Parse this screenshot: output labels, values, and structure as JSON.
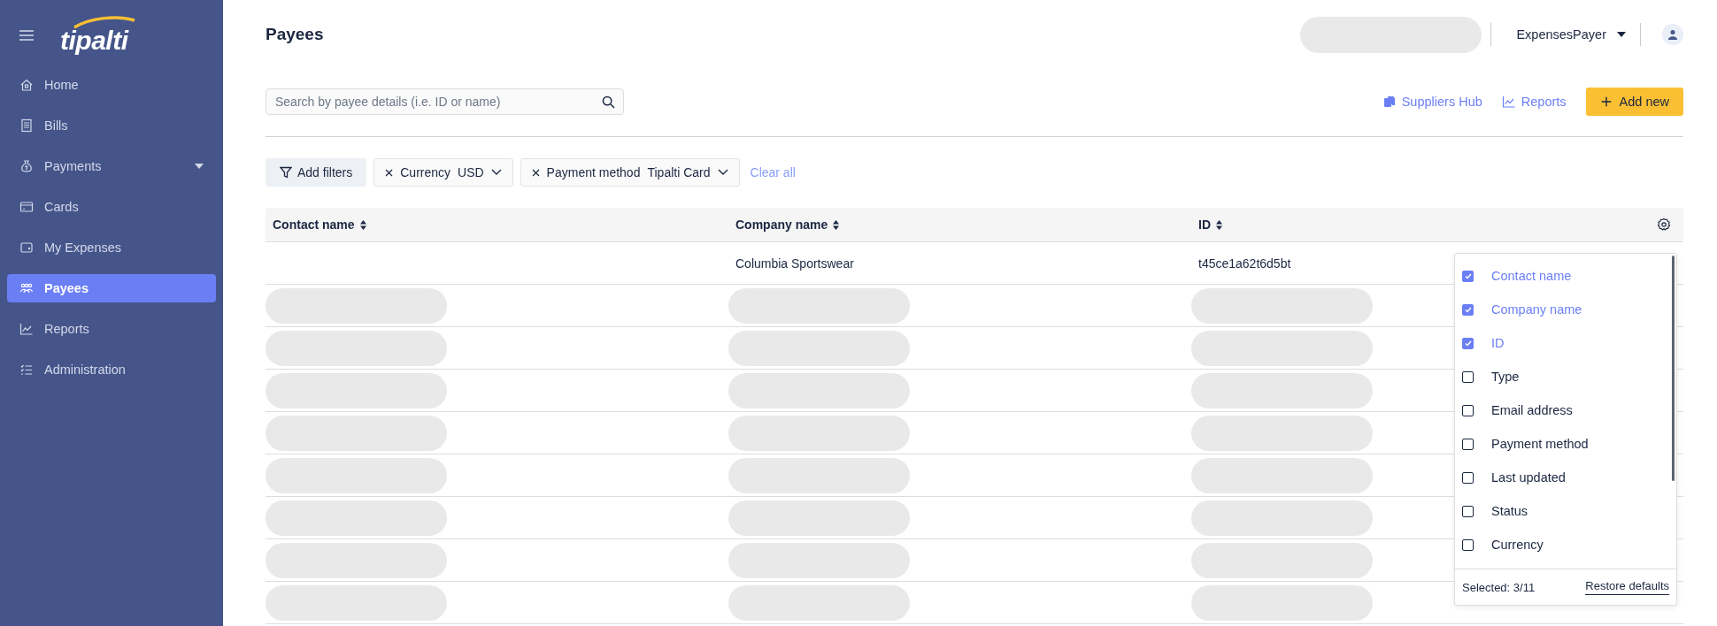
{
  "sidebar": {
    "logo": "tipalti",
    "items": [
      {
        "label": "Home",
        "selected": false,
        "expandable": false
      },
      {
        "label": "Bills",
        "selected": false,
        "expandable": false
      },
      {
        "label": "Payments",
        "selected": false,
        "expandable": true
      },
      {
        "label": "Cards",
        "selected": false,
        "expandable": false
      },
      {
        "label": "My Expenses",
        "selected": false,
        "expandable": false
      },
      {
        "label": "Payees",
        "selected": true,
        "expandable": false
      },
      {
        "label": "Reports",
        "selected": false,
        "expandable": false
      },
      {
        "label": "Administration",
        "selected": false,
        "expandable": false
      }
    ]
  },
  "header": {
    "title": "Payees",
    "account_loading": true,
    "user": "ExpensesPayer"
  },
  "search": {
    "placeholder": "Search by payee details (i.e. ID or name)"
  },
  "actions": [
    {
      "label": "Suppliers Hub",
      "kind": "link"
    },
    {
      "label": "Reports",
      "kind": "link"
    },
    {
      "label": "Add new",
      "kind": "primary"
    }
  ],
  "filters": {
    "add_label": "Add filters",
    "chips": [
      {
        "name": "Currency",
        "value": "USD"
      },
      {
        "name": "Payment method",
        "value": "Tipalti Card"
      }
    ],
    "clear_label": "Clear all"
  },
  "table": {
    "columns": [
      "Contact name",
      "Company name",
      "ID"
    ],
    "rows": [
      {
        "kind": "data",
        "cells": [
          "",
          "Columbia Sportswear",
          "t45ce1a62t6d5bt"
        ]
      },
      {
        "kind": "loading"
      },
      {
        "kind": "loading"
      },
      {
        "kind": "loading"
      },
      {
        "kind": "loading"
      },
      {
        "kind": "loading"
      },
      {
        "kind": "loading"
      },
      {
        "kind": "loading"
      },
      {
        "kind": "loading"
      }
    ]
  },
  "column_menu": {
    "options": [
      {
        "label": "Contact name",
        "checked": true
      },
      {
        "label": "Company name",
        "checked": true
      },
      {
        "label": "ID",
        "checked": true
      },
      {
        "label": "Type",
        "checked": false
      },
      {
        "label": "Email address",
        "checked": false
      },
      {
        "label": "Payment method",
        "checked": false
      },
      {
        "label": "Last updated",
        "checked": false
      },
      {
        "label": "Status",
        "checked": false
      },
      {
        "label": "Currency",
        "checked": false
      }
    ],
    "selected_count": "Selected: 3/11",
    "restore_label": "Restore defaults"
  }
}
